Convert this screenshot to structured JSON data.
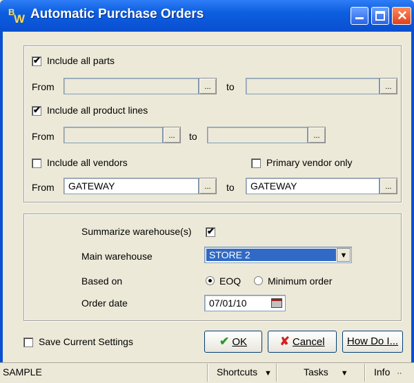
{
  "window": {
    "icon_letters": {
      "b": "B",
      "w": "W"
    },
    "title": "Automatic Purchase Orders"
  },
  "parts": {
    "include_label": "Include all parts",
    "include_checked": true,
    "from_label": "From",
    "from_value": "",
    "to_label": "to",
    "to_value": ""
  },
  "product_lines": {
    "include_label": "Include all product lines",
    "include_checked": true,
    "from_label": "From",
    "from_value": "",
    "to_label": "to",
    "to_value": ""
  },
  "vendors": {
    "include_label": "Include all vendors",
    "include_checked": false,
    "primary_label": "Primary vendor only",
    "primary_checked": false,
    "from_label": "From",
    "from_value": "GATEWAY",
    "to_label": "to",
    "to_value": "GATEWAY"
  },
  "ellipsis": "...",
  "warehouse": {
    "summarize_label": "Summarize warehouse(s)",
    "summarize_checked": true,
    "main_label": "Main warehouse",
    "main_value": "STORE 2",
    "based_on_label": "Based on",
    "based_on_options": [
      "EOQ",
      "Minimum order"
    ],
    "based_on_selected": "EOQ",
    "order_date_label": "Order date",
    "order_date_value": "07/01/10"
  },
  "footer": {
    "save_settings_label": "Save Current Settings",
    "save_settings_checked": false,
    "ok_label": "OK",
    "cancel_label": "Cancel",
    "howdoi_label": "How Do I..."
  },
  "statusbar": {
    "left_text": "SAMPLE",
    "shortcuts_label": "Shortcuts",
    "tasks_label": "Tasks",
    "info_label": "Info"
  },
  "colors": {
    "title_bar": "#0a4fd0",
    "selection": "#316ac5",
    "ok_check": "#2a9a2a",
    "cancel_x": "#d42020"
  }
}
